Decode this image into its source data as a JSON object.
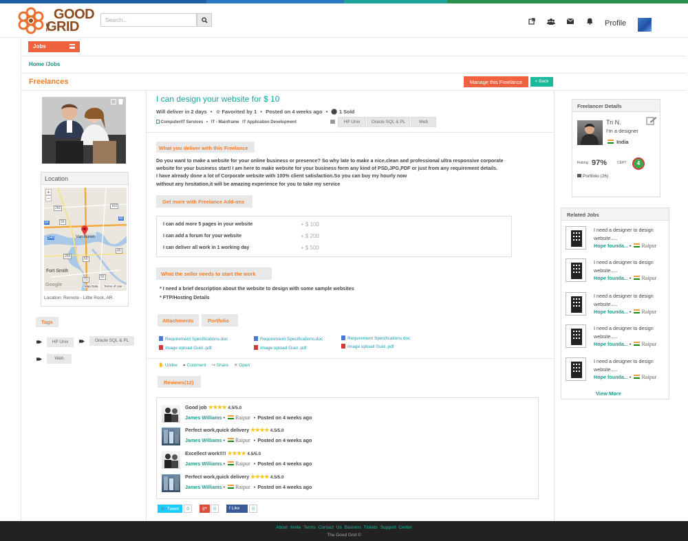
{
  "header": {
    "logo": {
      "the": "THE",
      "good": "GOOD",
      "grid": "GRID"
    },
    "search_placeholder": "Search...",
    "profile_label": "Profile",
    "icons": [
      "external-link-icon",
      "users-icon",
      "envelope-icon",
      "bell-icon"
    ]
  },
  "nav": {
    "jobs_label": "Jobs"
  },
  "breadcrumb": "Home /Jobs",
  "page": {
    "section_title": "Freelances",
    "manage_label": "Manage this Freelance",
    "back_label": "< Back"
  },
  "location": {
    "title": "Location",
    "map": {
      "city_van_buren": "Van Buren",
      "city_fort_smith": "Fort Smith",
      "map_data": "Map Data",
      "terms": "Terms of Use",
      "google": "Google",
      "zoom_in": "+",
      "zoom_out": "−",
      "road_labels": [
        "162",
        "282",
        "64",
        "59",
        "40",
        "45",
        "59",
        "71",
        "540",
        "255",
        "59"
      ]
    },
    "caption": "Location: Remote - Little Rock, AR."
  },
  "tags": {
    "title": "Tags",
    "items": [
      "HP Unix",
      "Oracle SQL & PL",
      "Web"
    ]
  },
  "listing": {
    "title": "I can design your website for $ 10",
    "delivery": "Will deliver in 2 days",
    "favorited": "Favorited by 1",
    "posted": "Posted on 4 weeks ago",
    "sold": "1 Sold",
    "category": "Computer/IT Services",
    "sub1": "IT - Mainframe",
    "sub2": "IT Application Development",
    "pills": [
      "HP Unix",
      "Oracle SQL & PL",
      "Web"
    ]
  },
  "deliver": {
    "label": "What you deliver with this Freelance",
    "lines": [
      "Do you want to make a website for your online business or presence? So why late to make a nice,clean and professional ultra responsive corporate",
      "website for your business start!   I am here to make website for your business form any kind of PSD,JPG,PDF or just from any requirement details.",
      "I have already done a lot of Corporate website with 100% client satisfaction.So you can buy my hourly now",
      "without any hesitation,it will be amazing experience for you to take my service"
    ]
  },
  "addons": {
    "label": "Get more with Freelance Add-ons",
    "items": [
      {
        "text": "I can add more 5 pages in your website",
        "price": "+ $ 100"
      },
      {
        "text": "I can add a forum for your website",
        "price": "+ $  200"
      },
      {
        "text": "I can deliver all work in 1 working day",
        "price": "+ $  500"
      }
    ]
  },
  "needs": {
    "label": "What the seller needs to start the work",
    "items": [
      "* I need a brief description about the website to design with some sample websites",
      "* FTP/Hosting Details"
    ]
  },
  "tabs": {
    "attachments": "Attachments",
    "portfolio": "Portfolio"
  },
  "attachments": [
    "Requirement Specifications.doc",
    "Requirement Specifications.doc",
    "Requirement Specifications.doc",
    "Image upload Guid .pdf",
    "Image upload Guid .pdf",
    "Image upload Guid .pdf"
  ],
  "actions": {
    "unlike": "Unlike",
    "comment": "Comment",
    "share": "Share",
    "open": "Open"
  },
  "reviews": {
    "label": "Reviews(12)",
    "items": [
      {
        "title": "Good job",
        "stars": "★★★★",
        "score": "4.5/5.0",
        "name": "James Williams",
        "city": "Raipur",
        "posted": "Posted on 4 weeks ago"
      },
      {
        "title": "Perfect work,quick delivery",
        "stars": "★★★★",
        "score": "4.5/5.0",
        "name": "James Williams",
        "city": "Raipur",
        "posted": "Posted on 4 weeks ago"
      },
      {
        "title": "Excellect work!!!!",
        "stars": "★★★★",
        "score": "4.5/5.0",
        "name": "James Williams",
        "city": "Raipur",
        "posted": "Posted on 4 weeks ago"
      },
      {
        "title": "Perfect work,quick delivery",
        "stars": "★★★★",
        "score": "4.5/5.0",
        "name": "James Williams",
        "city": "Raipur",
        "posted": "Posted on 4 weeks ago"
      }
    ]
  },
  "share": {
    "tweet": "Tweet",
    "tweet_count": "0",
    "gplus": "g+",
    "gplus_count": "0",
    "like": "f Like",
    "like_count": "0"
  },
  "freelancer": {
    "title": "Freelancer Details",
    "name": "Tri N.",
    "role": "I'm a designer",
    "country": "India",
    "rating_label": "Rating",
    "rating": "97%",
    "cert_label": "CERT",
    "cert_num": "4",
    "portfolio": "Portfolio (26)"
  },
  "related": {
    "title": "Related  Jobs",
    "items": [
      {
        "title1": "I need a designer to design",
        "title2": "website.....",
        "company": "Hope founda...",
        "city": "Raipur"
      },
      {
        "title1": "I need a designer to design",
        "title2": "website.....",
        "company": "Hope founda...",
        "city": "Raipur"
      },
      {
        "title1": "I need a designer to design",
        "title2": "website.....",
        "company": "Hope founda...",
        "city": "Raipur"
      },
      {
        "title1": "I need a designer to design",
        "title2": "website.....",
        "company": "Hope founda...",
        "city": "Raipur"
      },
      {
        "title1": "I need a designer to design",
        "title2": "website.....",
        "company": "Hope founda...",
        "city": "Raipur"
      }
    ],
    "view_more": "View More"
  },
  "footer": {
    "links": [
      "About",
      "Invite",
      "Terms",
      "Contact Us",
      "Banners",
      "Tickets",
      "Support Center"
    ],
    "copyright": "The Good Grid ©"
  },
  "colors": {
    "accent_orange": "#f0623f",
    "accent_teal": "#1aa39a",
    "title_orange": "#f07d2a"
  }
}
